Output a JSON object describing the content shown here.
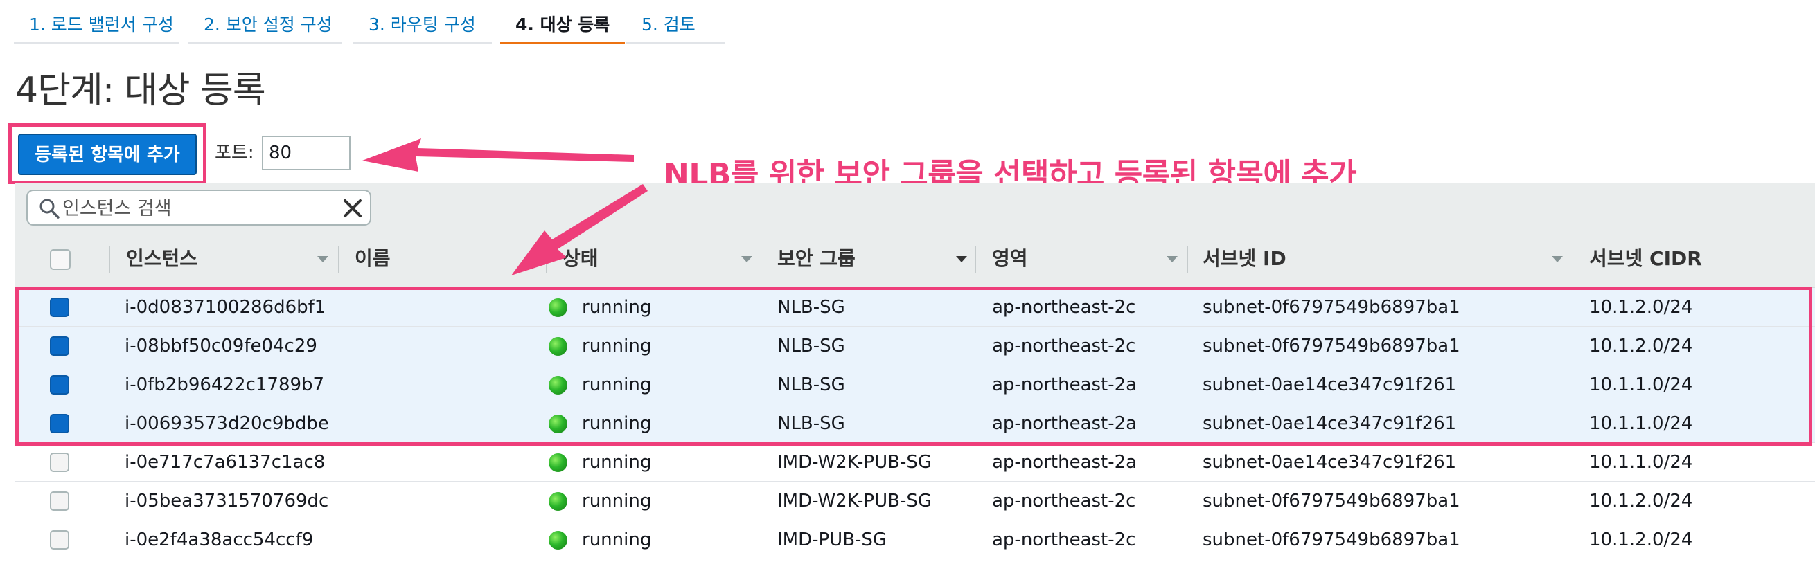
{
  "wizard": {
    "steps": [
      {
        "label": "1. 로드 밸런서 구성"
      },
      {
        "label": "2. 보안 설정 구성"
      },
      {
        "label": "3. 라우팅 구성"
      },
      {
        "label": "4. 대상 등록"
      },
      {
        "label": "5. 검토"
      }
    ],
    "active_step": 4
  },
  "page": {
    "title": "4단계: 대상 등록"
  },
  "actions": {
    "add_registered_label": "등록된 항목에 추가",
    "port_label": "포트:",
    "port_value": "80"
  },
  "annotation": {
    "callout": "NLB를 위한 보안 그룹을 선택하고 등록된 항목에 추가",
    "highlight_color": "#ee3e7a"
  },
  "search": {
    "placeholder": "인스턴스 검색",
    "icon": "search-icon",
    "clear_icon": "close-icon"
  },
  "table": {
    "columns": [
      {
        "label": "인스턴스"
      },
      {
        "label": "이름"
      },
      {
        "label": "상태"
      },
      {
        "label": "보안 그룹"
      },
      {
        "label": "영역"
      },
      {
        "label": "서브넷 ID"
      },
      {
        "label": "서브넷 CIDR"
      }
    ],
    "rows": [
      {
        "selected": true,
        "instance": "i-0d0837100286d6bf1",
        "name": "",
        "state": "running",
        "security_group": "NLB-SG",
        "zone": "ap-northeast-2c",
        "subnet_id": "subnet-0f6797549b6897ba1",
        "cidr": "10.1.2.0/24"
      },
      {
        "selected": true,
        "instance": "i-08bbf50c09fe04c29",
        "name": "",
        "state": "running",
        "security_group": "NLB-SG",
        "zone": "ap-northeast-2c",
        "subnet_id": "subnet-0f6797549b6897ba1",
        "cidr": "10.1.2.0/24"
      },
      {
        "selected": true,
        "instance": "i-0fb2b96422c1789b7",
        "name": "",
        "state": "running",
        "security_group": "NLB-SG",
        "zone": "ap-northeast-2a",
        "subnet_id": "subnet-0ae14ce347c91f261",
        "cidr": "10.1.1.0/24"
      },
      {
        "selected": true,
        "instance": "i-00693573d20c9bdbe",
        "name": "",
        "state": "running",
        "security_group": "NLB-SG",
        "zone": "ap-northeast-2a",
        "subnet_id": "subnet-0ae14ce347c91f261",
        "cidr": "10.1.1.0/24"
      },
      {
        "selected": false,
        "instance": "i-0e717c7a6137c1ac8",
        "name": "",
        "state": "running",
        "security_group": "IMD-W2K-PUB-SG",
        "zone": "ap-northeast-2a",
        "subnet_id": "subnet-0ae14ce347c91f261",
        "cidr": "10.1.1.0/24"
      },
      {
        "selected": false,
        "instance": "i-05bea3731570769dc",
        "name": "",
        "state": "running",
        "security_group": "IMD-W2K-PUB-SG",
        "zone": "ap-northeast-2c",
        "subnet_id": "subnet-0f6797549b6897ba1",
        "cidr": "10.1.2.0/24"
      },
      {
        "selected": false,
        "instance": "i-0e2f4a38acc54ccf9",
        "name": "",
        "state": "running",
        "security_group": "IMD-PUB-SG",
        "zone": "ap-northeast-2c",
        "subnet_id": "subnet-0f6797549b6897ba1",
        "cidr": "10.1.2.0/24"
      }
    ]
  }
}
